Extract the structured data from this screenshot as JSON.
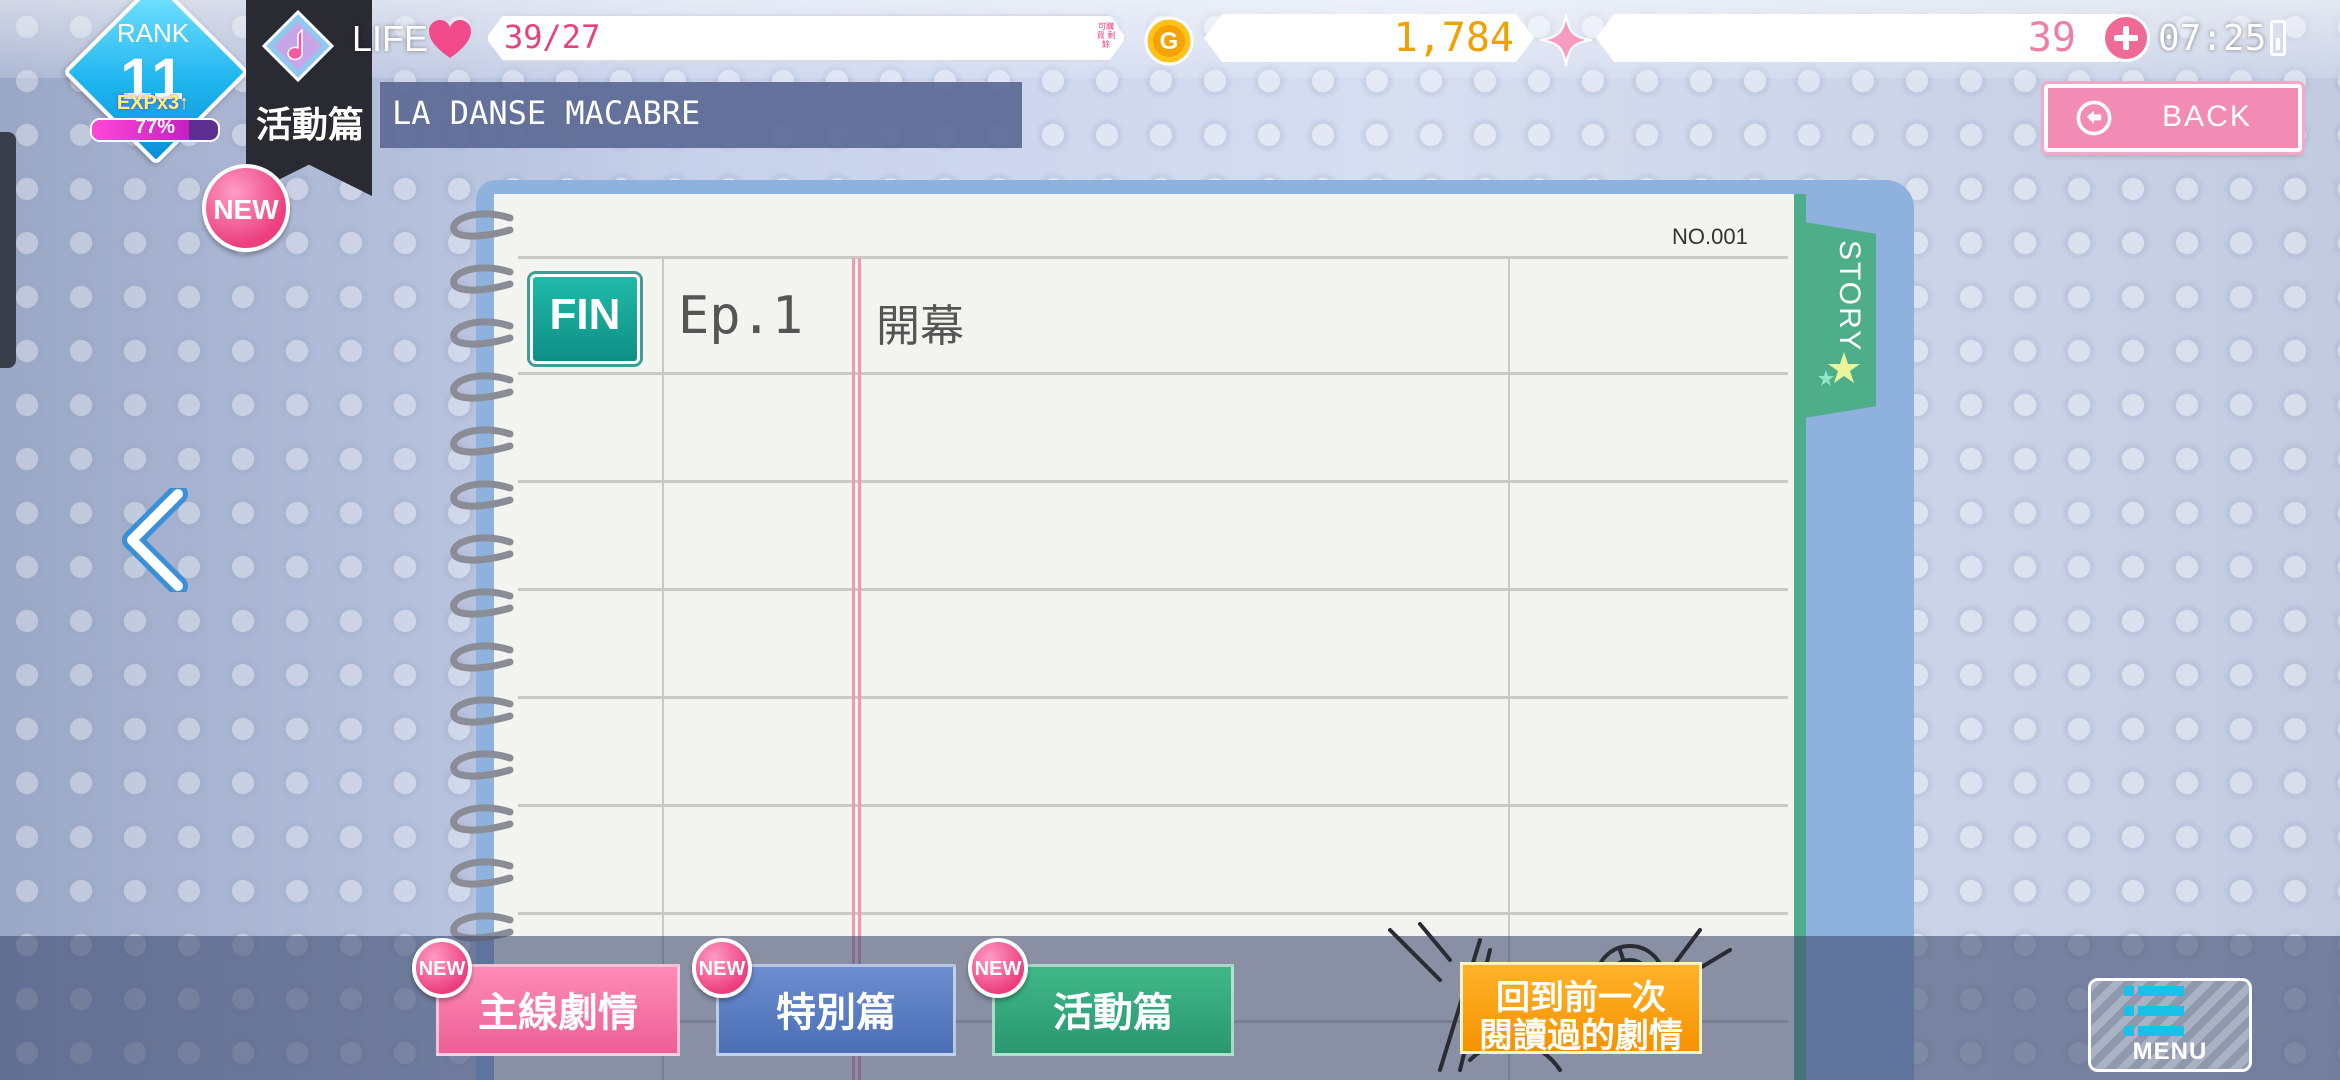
{
  "top_bar": {
    "rank_label": "RANK",
    "rank_value": "11",
    "exp_label": "EXPx3↑",
    "exp_percent_text": "77%",
    "exp_percent": 0.77,
    "event_label": "活動篇",
    "life_label": "LIFE",
    "life_value": "39/27",
    "life_tiny": "可購買 剩餘",
    "gold_value": "1,784",
    "gem_value": "39",
    "clock": "07:25"
  },
  "header": {
    "story_title": "LA DANSE MACABRE",
    "back_label": "BACK",
    "new_badge": "NEW"
  },
  "notebook": {
    "page_no": "NO.001",
    "tab_label": "STORY",
    "episodes": [
      {
        "status": "FIN",
        "episode": "Ep.1",
        "title": "開幕"
      }
    ]
  },
  "bottom": {
    "tabs": [
      {
        "label": "主線劇情",
        "badge": "NEW"
      },
      {
        "label": "特別篇",
        "badge": "NEW"
      },
      {
        "label": "活動篇",
        "badge": "NEW"
      }
    ],
    "resume_line1": "回到前一次",
    "resume_line2": "閱讀過的劇情",
    "menu_label": "MENU"
  },
  "colors": {
    "accent_pink": "#ec5f96",
    "accent_blue": "#4b6eb5",
    "accent_green": "#2a9770",
    "accent_orange": "#f59200",
    "gold_text": "#f0a000",
    "rank_blue": "#1fb6ef"
  },
  "icons": [
    "music-note-icon",
    "heart-icon",
    "gold-coin-icon",
    "sparkle-gem-icon",
    "plus-icon",
    "battery-icon",
    "back-arrow-icon",
    "chevron-left-icon",
    "star-icon",
    "menu-list-icon"
  ]
}
